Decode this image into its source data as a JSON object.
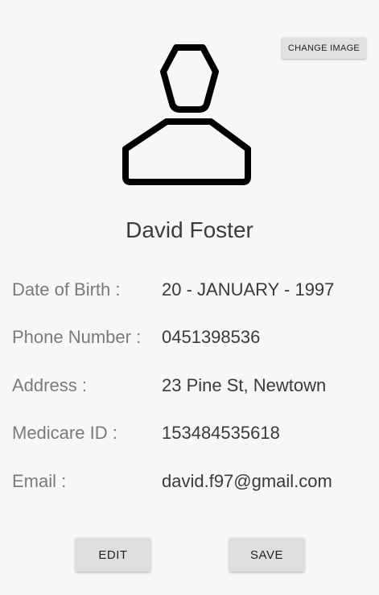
{
  "header": {
    "change_image_label": "CHANGE IMAGE",
    "avatar_icon": "person-outline-icon"
  },
  "profile": {
    "name": "David Foster"
  },
  "details": [
    {
      "label": "Date of Birth :",
      "value": "20 - JANUARY - 1997"
    },
    {
      "label": "Phone Number :",
      "value": "0451398536"
    },
    {
      "label": "Address :",
      "value": "23 Pine St, Newtown"
    },
    {
      "label": "Medicare ID :",
      "value": "153484535618"
    },
    {
      "label": "Email :",
      "value": "david.f97@gmail.com"
    }
  ],
  "actions": {
    "edit_label": "EDIT",
    "save_label": "SAVE"
  },
  "colors": {
    "background": "#f7f7f7",
    "button": "#e0e0e0",
    "label_text": "#7a7a7a",
    "value_text": "#3a3a3a",
    "icon_stroke": "#000000"
  }
}
